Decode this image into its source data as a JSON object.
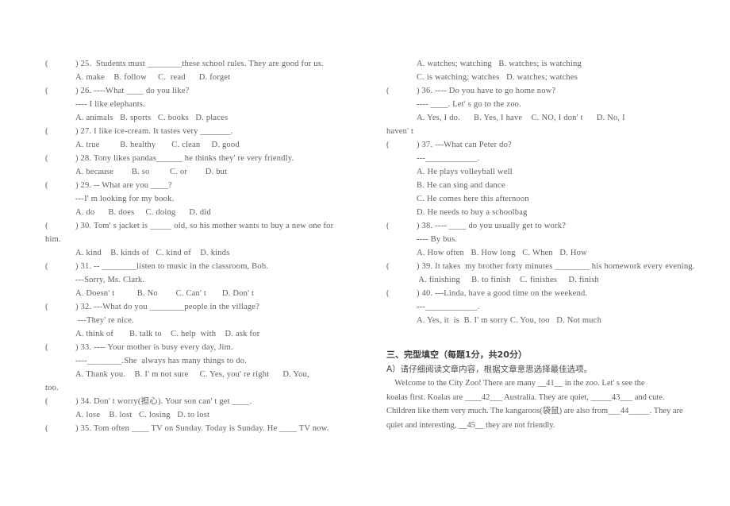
{
  "document": {
    "kind": "english-exam-paper",
    "page_background": "#ffffff",
    "text_color": "#5d5d5d"
  },
  "left_column": {
    "questions": [
      {
        "paren": "(",
        "stem": ") 25.  Students must ________these school rules. They are good for us.",
        "lines": [
          {
            "indent": true,
            "text": "A. make    B. follow     C.  read      D. forget"
          }
        ]
      },
      {
        "paren": "(",
        "stem": ") 26. ----What ____ do you like?",
        "lines": [
          {
            "indent": true,
            "text": "---- I like elephants."
          },
          {
            "indent": true,
            "text": "A. animals   B. sports   C. books   D. places"
          }
        ]
      },
      {
        "paren": "(",
        "stem": ") 27. I like ice-cream. It tastes very _______.",
        "lines": [
          {
            "indent": true,
            "text": "A. true         B. healthy       C. clean     D. good"
          }
        ]
      },
      {
        "paren": "(",
        "stem": ") 28. Tony likes pandas______ he thinks they' re very friendly.",
        "lines": [
          {
            "indent": true,
            "text": "A. because        B. so         C. or        D. but"
          }
        ]
      },
      {
        "paren": "(",
        "stem": ") 29. -- What are you ____?",
        "lines": [
          {
            "indent": true,
            "text": "---I' m looking for my book."
          },
          {
            "indent": true,
            "text": "A. do      B. does     C. doing      D. did"
          }
        ]
      },
      {
        "paren": "(",
        "stem": ") 30. Tom' s jacket is _____ old, so his mother wants to buy a new one for",
        "lines": [
          {
            "indent": false,
            "text": "him."
          },
          {
            "indent": true,
            "text": "A. kind    B. kinds of   C. kind of    D. kinds"
          }
        ]
      },
      {
        "paren": "(",
        "stem": ") 31. -- ________listen to music in the classroom, Bob.",
        "lines": [
          {
            "indent": true,
            "text": "---Sorry, Ms. Clark."
          },
          {
            "indent": true,
            "text": "A. Doesn' t          B. No        C. Can' t       D. Don' t"
          }
        ]
      },
      {
        "paren": "(",
        "stem": ") 32. ---What do you ________people in the village?",
        "lines": [
          {
            "indent": true,
            "text": " ---They' re nice."
          },
          {
            "indent": true,
            "text": "A. think of       B. talk to    C. help  with    D. ask for"
          }
        ]
      },
      {
        "paren": "(",
        "stem": ") 33. ---- Your mother is busy every day, Jim.",
        "lines": [
          {
            "indent": true,
            "text": "----________.She  always has many things to do."
          },
          {
            "indent": true,
            "text": "A. Thank you.    B. I' m not sure     C. Yes, you' re right      D. You,"
          },
          {
            "indent": false,
            "text": "too."
          }
        ]
      },
      {
        "paren": "(",
        "stem": ") 34. Don' t worry(担心). Your son can' t get ____.",
        "lines": [
          {
            "indent": true,
            "text": "A. lose    B. lost   C. losing   D. to lost"
          }
        ]
      },
      {
        "paren": "(",
        "stem": ") 35. Tom often ____ TV on Sunday. Today is Sunday. He ____ TV now.",
        "lines": []
      }
    ]
  },
  "right_column": {
    "leading_options": [
      "A. watches; watching   B. watches; is watching",
      "C. is watching; watches   D. watches; watches"
    ],
    "questions": [
      {
        "paren": "(",
        "stem": ") 36. ---- Do you have to go home now?",
        "lines": [
          {
            "indent": true,
            "text": "---- ____. Let' s go to the zoo."
          },
          {
            "indent": true,
            "text": "A. Yes, I do.      B. Yes, I have    C. NO, I don' t      D. No, I"
          },
          {
            "indent": false,
            "text": "haven' t"
          }
        ]
      },
      {
        "paren": "(",
        "stem": ") 37. ---What can Peter do?",
        "lines": [
          {
            "indent": true,
            "text": "---____________."
          },
          {
            "indent": true,
            "text": "A. He plays volleyball well"
          },
          {
            "indent": true,
            "text": "B. He can sing and dance"
          },
          {
            "indent": true,
            "text": "C. He comes here this afternoon"
          },
          {
            "indent": true,
            "text": "D. He needs to buy a schoolbag"
          }
        ]
      },
      {
        "paren": "(",
        "stem": ") 38. ---- ____ do you usually get to work?",
        "lines": [
          {
            "indent": true,
            "text": "---- By bus."
          },
          {
            "indent": true,
            "text": "A. How often   B. How long   C. When   D. How"
          }
        ]
      },
      {
        "paren": "(",
        "stem": ") 39. It takes  my brother forty minutes ________ his homework every evening.",
        "lines": [
          {
            "indent": true,
            "text": " A. finishing     B. to finish    C. finishes     D. finish"
          }
        ]
      },
      {
        "paren": "(",
        "stem": ") 40. ---Linda, have a good time on the weekend.",
        "lines": [
          {
            "indent": true,
            "text": "---____________."
          },
          {
            "indent": true,
            "text": "A. Yes, it  is  B. I' m sorry C. You, too   D. Not much"
          }
        ]
      }
    ]
  },
  "section_three": {
    "heading": "三、完型填空（每题1分，共20分）",
    "subheading": "A）请仔细阅读文章内容，根据文章意思选择最佳选项。",
    "passage_lines": [
      "    Welcome to the City Zoo! There are many __41__ in the zoo. Let' s see the",
      "koalas first. Koalas are ____42___ Australia. They are quiet, _____43___ and cute.",
      "Children like them very much. The kangaroos(袋鼠) are also from___44_____. They are",
      "quiet and interesting, __45__ they are not friendly."
    ]
  }
}
